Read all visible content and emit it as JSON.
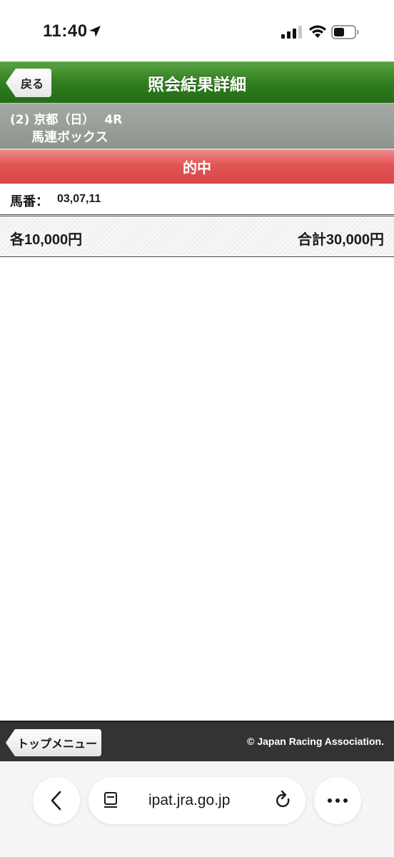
{
  "status_bar": {
    "time": "11:40"
  },
  "header": {
    "back_label": "戻る",
    "title": "照会結果詳細"
  },
  "race": {
    "number": "(2)",
    "venue_day": "京都（日）",
    "race": "4R",
    "bet_type": "馬連ボックス"
  },
  "result": {
    "status": "的中"
  },
  "horses": {
    "label": "馬番：",
    "value": "03,07,11"
  },
  "amounts": {
    "each": "各10,000円",
    "total": "合計30,000円"
  },
  "footer": {
    "top_menu_label": "トップメニュー",
    "copyright": "© Japan Racing Association."
  },
  "browser": {
    "url": "ipat.jra.go.jp"
  },
  "colors": {
    "header_green": "#2f7e1f",
    "race_band_gray": "#8e958e",
    "hit_red": "#d84848",
    "footer_dark": "#333333"
  },
  "icons": [
    "location-arrow-icon",
    "cellular-signal-icon",
    "wifi-icon",
    "battery-icon",
    "chevron-left-icon",
    "reader-mode-icon",
    "reload-icon",
    "more-icon"
  ]
}
